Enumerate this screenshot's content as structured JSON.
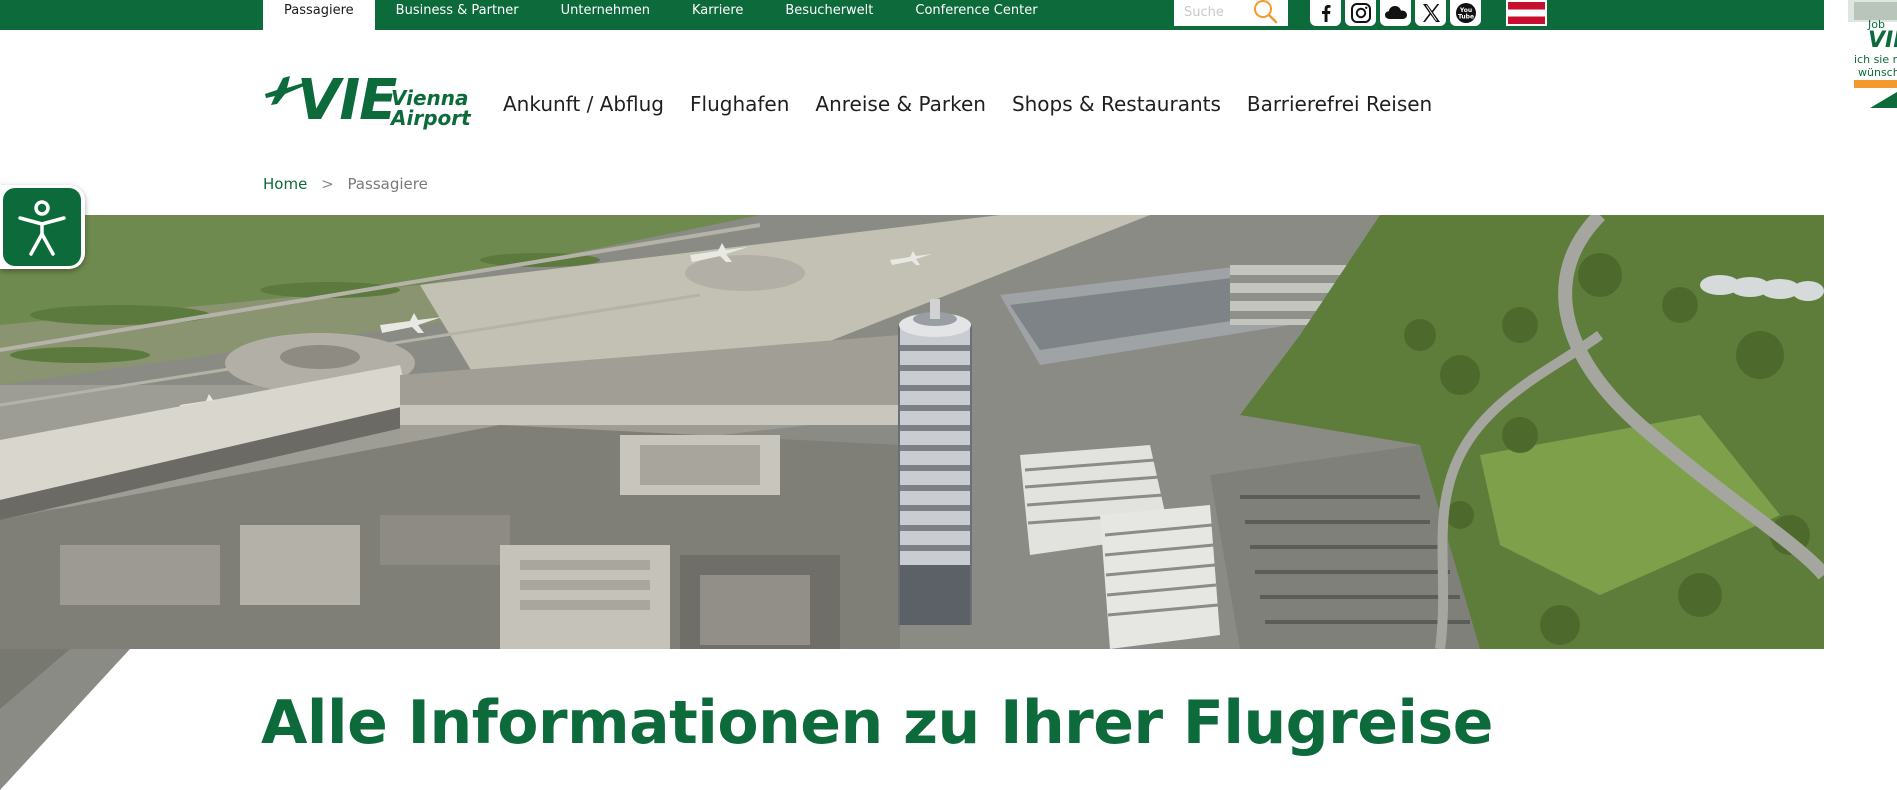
{
  "top_nav": {
    "tabs": [
      {
        "label": "Passagiere",
        "active": true
      },
      {
        "label": "Business & Partner",
        "active": false
      },
      {
        "label": "Unternehmen",
        "active": false
      },
      {
        "label": "Karriere",
        "active": false
      },
      {
        "label": "Besucherwelt",
        "active": false
      },
      {
        "label": "Conference Center",
        "active": false
      }
    ],
    "search_placeholder": "Suche",
    "social_icons": [
      "facebook-icon",
      "instagram-icon",
      "cloud-icon",
      "x-icon",
      "youtube-icon"
    ],
    "language_flag": "austria-flag-icon"
  },
  "side_ad": {
    "line1": "Job",
    "line2": "VIE",
    "line3a": "ich sie mi",
    "line3b": "wünsch"
  },
  "logo": {
    "mark": "VIE",
    "line1": "Vienna",
    "line2": "Airport"
  },
  "main_nav": [
    {
      "label": "Ankunft / Abflug"
    },
    {
      "label": "Flughafen"
    },
    {
      "label": "Anreise & Parken"
    },
    {
      "label": "Shops & Restaurants"
    },
    {
      "label": "Barrierefrei Reisen"
    }
  ],
  "breadcrumb": {
    "home": "Home",
    "separator": ">",
    "current": "Passagiere"
  },
  "hero_image": "airport-aerial-photo",
  "accessibility_icon": "accessibility-person-icon",
  "headline": "Alle Informationen zu Ihrer Flugreise",
  "colors": {
    "brand_green": "#0d6b3b",
    "accent_orange": "#f29a2e",
    "flag_red": "#c8102e"
  }
}
